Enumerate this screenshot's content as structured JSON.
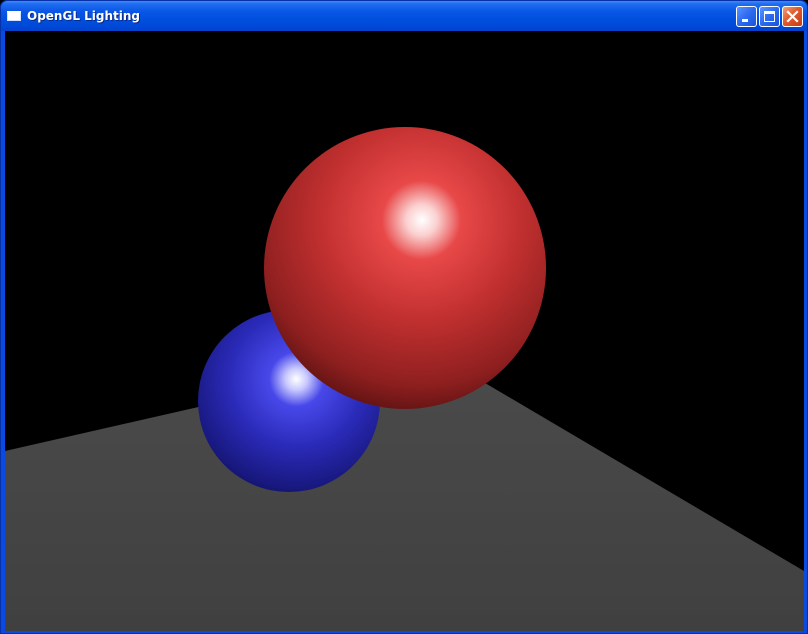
{
  "window": {
    "title": "OpenGL Lighting",
    "icon": "window-icon",
    "controls": [
      "minimize-icon",
      "maximize-icon",
      "close-icon"
    ]
  },
  "scene": {
    "background_color": "#000000",
    "floor_color": "#464646",
    "objects": [
      {
        "name": "red-sphere",
        "color": "#c02828"
      },
      {
        "name": "blue-sphere",
        "color": "#2828c0"
      }
    ]
  }
}
